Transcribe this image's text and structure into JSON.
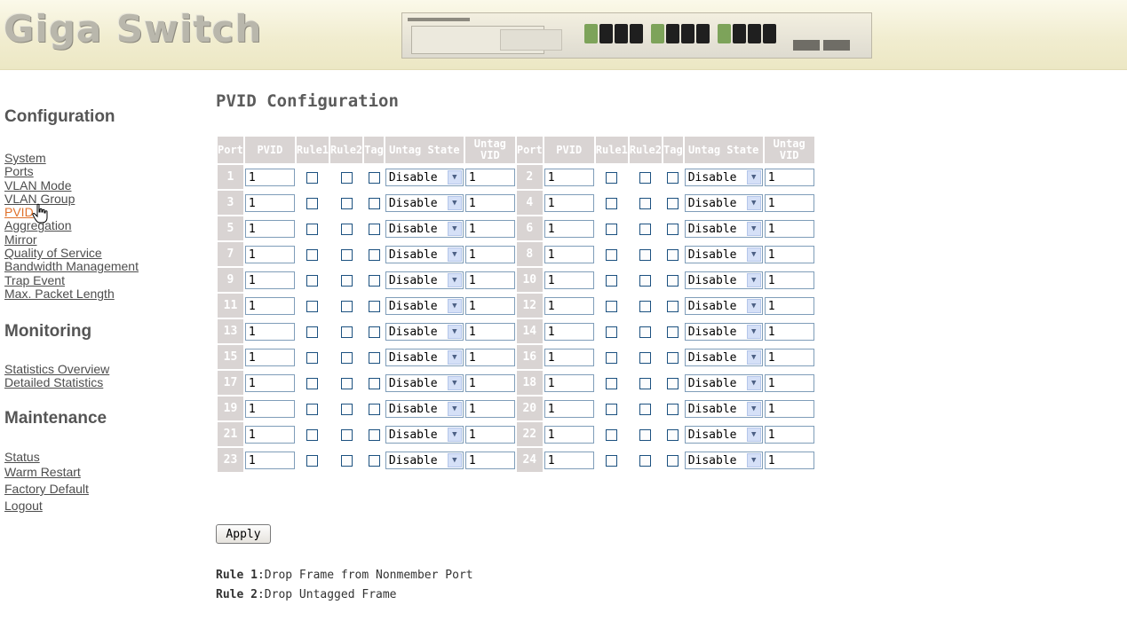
{
  "header": {
    "logo_text": "Giga Switch",
    "device_image": "switch-front-panel-image"
  },
  "sidebar": {
    "sections": [
      {
        "heading": "Configuration",
        "items": [
          "System",
          "Ports",
          "VLAN Mode",
          "VLAN Group",
          "PVID",
          "Aggregation",
          "Mirror",
          "Quality of Service",
          "Bandwidth Management",
          "Trap Event",
          "Max. Packet Length"
        ]
      },
      {
        "heading": "Monitoring",
        "items": [
          "Statistics Overview",
          "Detailed Statistics"
        ]
      },
      {
        "heading": "Maintenance",
        "items": [
          "Status",
          "Warm Restart",
          "Factory Default",
          "Logout"
        ]
      }
    ],
    "active_item": "PVID",
    "cursor_icon": "hand-pointer-icon"
  },
  "main": {
    "title": "PVID Configuration",
    "table": {
      "headers": [
        "Port",
        "PVID",
        "Rule1",
        "Rule2",
        "Tag",
        "Untag State",
        "Untag VID",
        "Port",
        "PVID",
        "Rule1",
        "Rule2",
        "Tag",
        "Untag State",
        "Untag VID"
      ],
      "rows": [
        {
          "left": {
            "port": "1",
            "pvid": "1",
            "rule1": false,
            "rule2": false,
            "tag": false,
            "untag_state": "Disable",
            "untag_vid": "1"
          },
          "right": {
            "port": "2",
            "pvid": "1",
            "rule1": false,
            "rule2": false,
            "tag": false,
            "untag_state": "Disable",
            "untag_vid": "1"
          }
        },
        {
          "left": {
            "port": "3",
            "pvid": "1",
            "rule1": false,
            "rule2": false,
            "tag": false,
            "untag_state": "Disable",
            "untag_vid": "1"
          },
          "right": {
            "port": "4",
            "pvid": "1",
            "rule1": false,
            "rule2": false,
            "tag": false,
            "untag_state": "Disable",
            "untag_vid": "1"
          }
        },
        {
          "left": {
            "port": "5",
            "pvid": "1",
            "rule1": false,
            "rule2": false,
            "tag": false,
            "untag_state": "Disable",
            "untag_vid": "1"
          },
          "right": {
            "port": "6",
            "pvid": "1",
            "rule1": false,
            "rule2": false,
            "tag": false,
            "untag_state": "Disable",
            "untag_vid": "1"
          }
        },
        {
          "left": {
            "port": "7",
            "pvid": "1",
            "rule1": false,
            "rule2": false,
            "tag": false,
            "untag_state": "Disable",
            "untag_vid": "1"
          },
          "right": {
            "port": "8",
            "pvid": "1",
            "rule1": false,
            "rule2": false,
            "tag": false,
            "untag_state": "Disable",
            "untag_vid": "1"
          }
        },
        {
          "left": {
            "port": "9",
            "pvid": "1",
            "rule1": false,
            "rule2": false,
            "tag": false,
            "untag_state": "Disable",
            "untag_vid": "1"
          },
          "right": {
            "port": "10",
            "pvid": "1",
            "rule1": false,
            "rule2": false,
            "tag": false,
            "untag_state": "Disable",
            "untag_vid": "1"
          }
        },
        {
          "left": {
            "port": "11",
            "pvid": "1",
            "rule1": false,
            "rule2": false,
            "tag": false,
            "untag_state": "Disable",
            "untag_vid": "1"
          },
          "right": {
            "port": "12",
            "pvid": "1",
            "rule1": false,
            "rule2": false,
            "tag": false,
            "untag_state": "Disable",
            "untag_vid": "1"
          }
        },
        {
          "left": {
            "port": "13",
            "pvid": "1",
            "rule1": false,
            "rule2": false,
            "tag": false,
            "untag_state": "Disable",
            "untag_vid": "1"
          },
          "right": {
            "port": "14",
            "pvid": "1",
            "rule1": false,
            "rule2": false,
            "tag": false,
            "untag_state": "Disable",
            "untag_vid": "1"
          }
        },
        {
          "left": {
            "port": "15",
            "pvid": "1",
            "rule1": false,
            "rule2": false,
            "tag": false,
            "untag_state": "Disable",
            "untag_vid": "1"
          },
          "right": {
            "port": "16",
            "pvid": "1",
            "rule1": false,
            "rule2": false,
            "tag": false,
            "untag_state": "Disable",
            "untag_vid": "1"
          }
        },
        {
          "left": {
            "port": "17",
            "pvid": "1",
            "rule1": false,
            "rule2": false,
            "tag": false,
            "untag_state": "Disable",
            "untag_vid": "1"
          },
          "right": {
            "port": "18",
            "pvid": "1",
            "rule1": false,
            "rule2": false,
            "tag": false,
            "untag_state": "Disable",
            "untag_vid": "1"
          }
        },
        {
          "left": {
            "port": "19",
            "pvid": "1",
            "rule1": false,
            "rule2": false,
            "tag": false,
            "untag_state": "Disable",
            "untag_vid": "1"
          },
          "right": {
            "port": "20",
            "pvid": "1",
            "rule1": false,
            "rule2": false,
            "tag": false,
            "untag_state": "Disable",
            "untag_vid": "1"
          }
        },
        {
          "left": {
            "port": "21",
            "pvid": "1",
            "rule1": false,
            "rule2": false,
            "tag": false,
            "untag_state": "Disable",
            "untag_vid": "1"
          },
          "right": {
            "port": "22",
            "pvid": "1",
            "rule1": false,
            "rule2": false,
            "tag": false,
            "untag_state": "Disable",
            "untag_vid": "1"
          }
        },
        {
          "left": {
            "port": "23",
            "pvid": "1",
            "rule1": false,
            "rule2": false,
            "tag": false,
            "untag_state": "Disable",
            "untag_vid": "1"
          },
          "right": {
            "port": "24",
            "pvid": "1",
            "rule1": false,
            "rule2": false,
            "tag": false,
            "untag_state": "Disable",
            "untag_vid": "1"
          }
        }
      ]
    },
    "apply_label": "Apply",
    "notes": [
      {
        "label": "Rule 1",
        "text": ":Drop Frame from Nonmember Port"
      },
      {
        "label": "Rule 2",
        "text": ":Drop Untagged Frame"
      }
    ]
  }
}
